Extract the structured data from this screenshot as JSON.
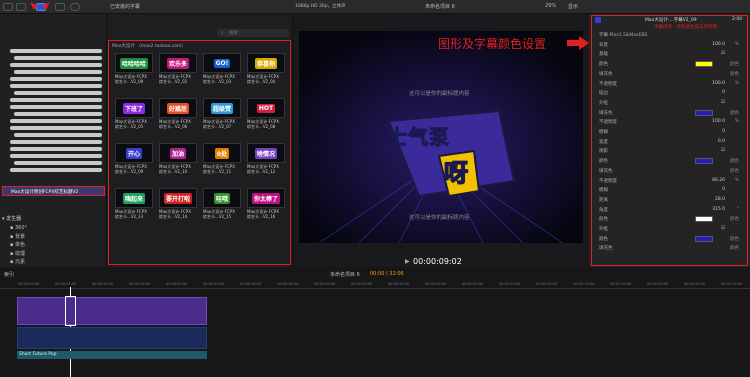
{
  "browser": {
    "filter": "已安装的字幕",
    "search_placeholder": "搜索",
    "section_title": "Max大设计 （max2.taobao.com）",
    "items": [
      {
        "label": "Max大设计-FCPX\n综艺卡...V2_09",
        "sticker": "哈哈哈哈",
        "bg": "#1b8f3c"
      },
      {
        "label": "Max大设计-FCPX\n综艺卡...V2_02",
        "sticker": "欢乐多",
        "bg": "#c2187a"
      },
      {
        "label": "Max大设计-FCPX\n综艺卡...V2_03",
        "sticker": "GO!",
        "bg": "#1a5fd0"
      },
      {
        "label": "Max大设计-FCPX\n综艺卡...V2_04",
        "sticker": "恭喜你",
        "bg": "#d8a800"
      },
      {
        "label": "Max大设计-FCPX\n综艺卡...V2_05",
        "sticker": "下班了",
        "bg": "#8a2be2"
      },
      {
        "label": "Max大设计-FCPX\n综艺卡...V2_06",
        "sticker": "好尴尬",
        "bg": "#e05020"
      },
      {
        "label": "Max大设计-FCPX\n综艺卡...V2_07",
        "sticker": "超级赞",
        "bg": "#2c9ad8"
      },
      {
        "label": "Max大设计-FCPX\n综艺卡...V2_08",
        "sticker": "HOT",
        "bg": "#d02040"
      },
      {
        "label": "Max大设计-FCPX\n综艺卡...V2_09",
        "sticker": "开心",
        "bg": "#3c3cd0"
      },
      {
        "label": "Max大设计-FCPX\n综艺卡...V2_10",
        "sticker": "加油",
        "bg": "#b02090"
      },
      {
        "label": "Max大设计-FCPX\n综艺卡...V2_11",
        "sticker": "0处",
        "bg": "#e08000"
      },
      {
        "label": "Max大设计-FCPX\n综艺卡...V2_12",
        "sticker": "啥情况",
        "bg": "#7040c0"
      },
      {
        "label": "Max大设计-FCPX\n综艺卡...V2_13",
        "sticker": "嗨起来",
        "bg": "#20a060"
      },
      {
        "label": "Max大设计-FCPX\n综艺卡...V2_14",
        "sticker": "要开打啦",
        "bg": "#d02020"
      },
      {
        "label": "Max大设计-FCPX\n综艺卡...V2_15",
        "sticker": "哇哦",
        "bg": "#309030"
      },
      {
        "label": "Max大设计-FCPX\n综艺卡...V2_16",
        "sticker": "你太棒了",
        "bg": "#c01080"
      }
    ]
  },
  "library": {
    "selected": "Max大设计原创FCPX综艺标题V2",
    "generators_header": "发生器",
    "generators": [
      "360°",
      "背景",
      "单色",
      "纹理",
      "元素"
    ]
  },
  "viewer": {
    "format": "1080p HD 30p，立体声",
    "title": "未命名项目 6",
    "zoom": "29%",
    "display": "显示",
    "subtitle_top": "这可以是你的副标题内容",
    "main_text_1": "士气泵",
    "main_text_2": "呀",
    "subtitle_bottom": "这可以是你的副标题内容",
    "timecode": "00:00:09:02"
  },
  "annotation": "图形及字幕颜色设置",
  "inspector": {
    "title": "Max大设计-...字幕V2_09",
    "duration": "2:00",
    "note": "字幕修改 - 修改颜色值与可修改",
    "rows": [
      {
        "label": "字幕 Max1.5&MaxEBS",
        "value": "",
        "unit": ""
      },
      {
        "label": "背景",
        "value": "100.0",
        "unit": "%"
      },
      {
        "label": "基础",
        "value": "☑",
        "unit": ""
      },
      {
        "label": "颜色",
        "value": "",
        "unit": "颜色",
        "swatch": "#ffff00"
      },
      {
        "label": "填充色",
        "value": "",
        "unit": "颜色"
      },
      {
        "label": "不透明度",
        "value": "100.0",
        "unit": "%"
      },
      {
        "label": "描边",
        "value": "0",
        "unit": ""
      },
      {
        "label": "外框",
        "value": "☑",
        "unit": ""
      },
      {
        "label": "填充色",
        "value": "",
        "unit": "颜色",
        "swatch": "#2020c0"
      },
      {
        "label": "不透明度",
        "value": "100.0",
        "unit": "%"
      },
      {
        "label": "模糊",
        "value": "0",
        "unit": ""
      },
      {
        "label": "宽度",
        "value": "0.0",
        "unit": ""
      },
      {
        "label": "阴影",
        "value": "☑",
        "unit": ""
      },
      {
        "label": "颜色",
        "value": "",
        "unit": "颜色",
        "swatch": "#2020c0"
      },
      {
        "label": "填充色",
        "value": "",
        "unit": "颜色"
      },
      {
        "label": "不透明度",
        "value": "86.26",
        "unit": "%"
      },
      {
        "label": "模糊",
        "value": "0",
        "unit": ""
      },
      {
        "label": "距离",
        "value": "28.0",
        "unit": ""
      },
      {
        "label": "角度",
        "value": "315.0",
        "unit": "°"
      },
      {
        "label": "颜色",
        "value": "",
        "unit": "颜色",
        "swatch": "#ffffff"
      },
      {
        "label": "外框",
        "value": "☑",
        "unit": ""
      },
      {
        "label": "颜色",
        "value": "",
        "unit": "颜色",
        "swatch": "#2020c0"
      },
      {
        "label": "填充色",
        "value": "",
        "unit": "颜色"
      }
    ]
  },
  "timeline": {
    "index": "索引",
    "project": "未命名项目 6",
    "time": "00:00 / 32:06",
    "clip_name": "Short Future Pop",
    "ticks": [
      "00:00:00:00",
      "00:00:05:00",
      "00:00:10:00",
      "00:00:15:00",
      "00:00:20:00",
      "00:00:25:00",
      "00:00:30:00",
      "00:00:35:00",
      "00:00:40:00",
      "00:00:45:00",
      "00:00:50:00",
      "00:00:55:00",
      "00:01:00:00",
      "00:01:05:00",
      "00:01:10:00",
      "00:01:15:00",
      "00:01:20:00",
      "00:01:25:00",
      "00:01:30:00",
      "00:01:35:00"
    ]
  }
}
